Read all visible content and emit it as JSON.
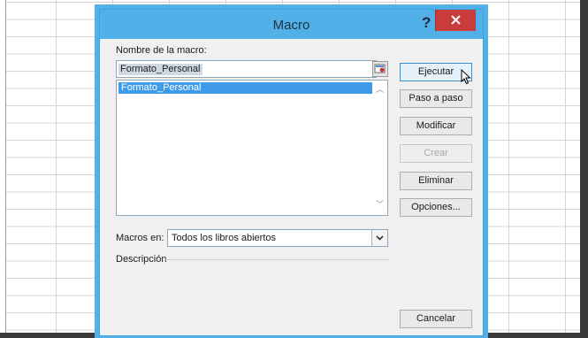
{
  "dialog": {
    "title": "Macro",
    "help_label": "?",
    "macro_name_label": "Nombre de la macro:",
    "macro_name_value": "Formato_Personal",
    "macro_list": [
      "Formato_Personal"
    ],
    "macros_in_label": "Macros en:",
    "macros_in_value": "Todos los libros abiertos",
    "description_label": "Descripción"
  },
  "buttons": {
    "run": "Ejecutar",
    "step": "Paso a paso",
    "edit": "Modificar",
    "create": "Crear",
    "delete": "Eliminar",
    "options": "Opciones...",
    "cancel": "Cancelar"
  },
  "colors": {
    "titlebar": "#52b0e8",
    "close": "#c83c3c",
    "selection": "#3d9be9"
  }
}
